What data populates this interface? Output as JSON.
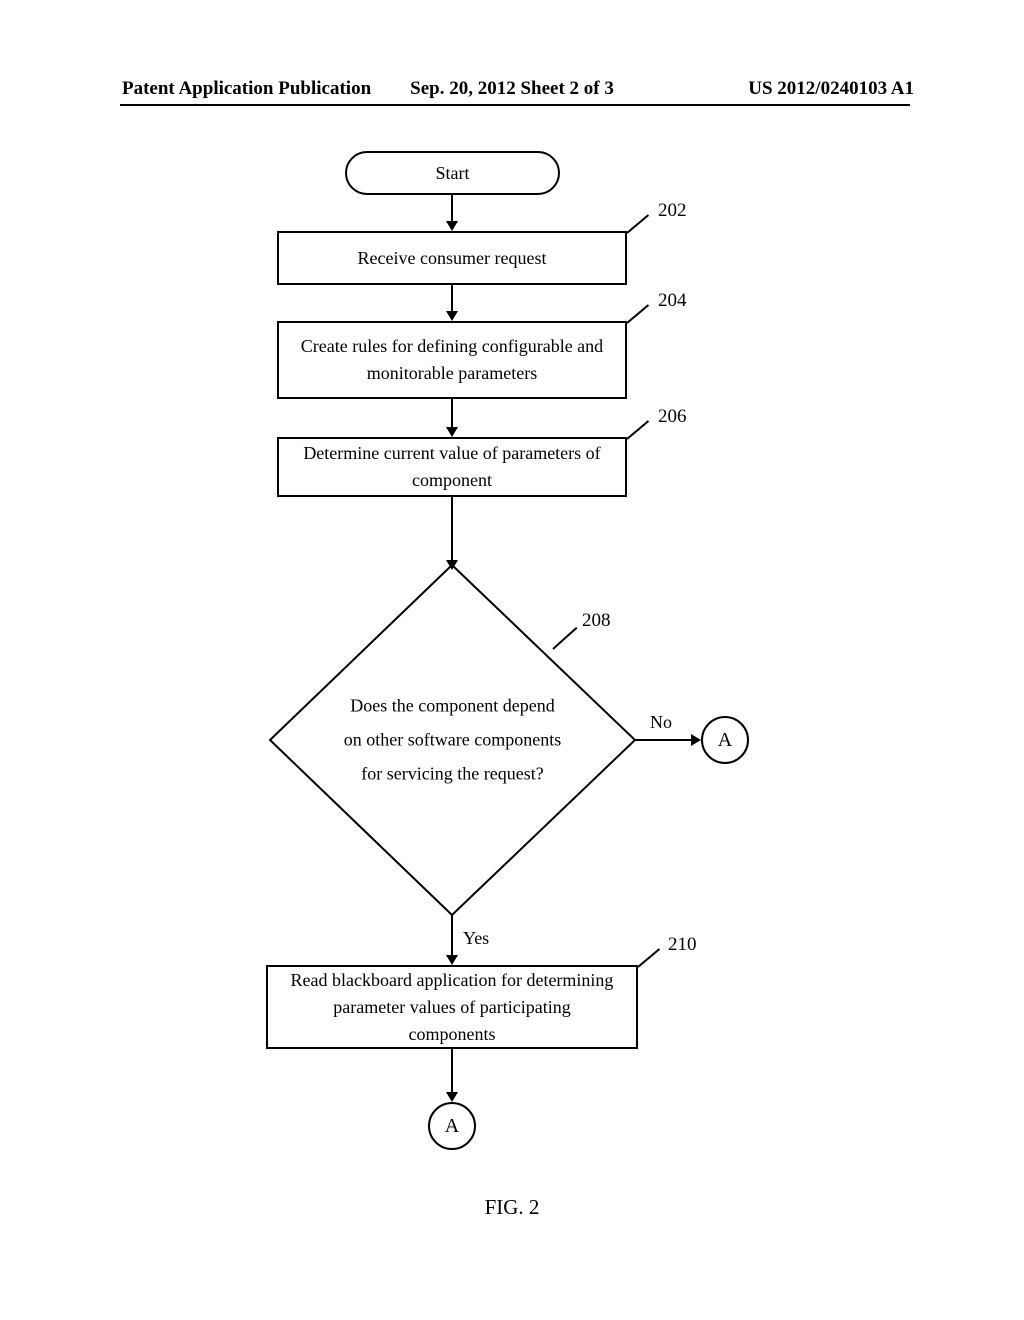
{
  "header": {
    "left": "Patent Application Publication",
    "center": "Sep. 20, 2012  Sheet 2 of 3",
    "right": "US 2012/0240103 A1"
  },
  "flow": {
    "start": "Start",
    "step202": {
      "ref": "202",
      "text": "Receive consumer request"
    },
    "step204": {
      "ref": "204",
      "text_l1": "Create rules for defining configurable and",
      "text_l2": "monitorable parameters"
    },
    "step206": {
      "ref": "206",
      "text_l1": "Determine current value of parameters of",
      "text_l2": "component"
    },
    "decision208": {
      "ref": "208",
      "line1": "Does the component depend",
      "line2": "on other software components",
      "line3": "for servicing the request?",
      "yes": "Yes",
      "no": "No"
    },
    "step210": {
      "ref": "210",
      "text_l1": "Read blackboard application for determining",
      "text_l2": "parameter values of participating",
      "text_l3": "components"
    },
    "connectorA": "A"
  },
  "caption": "FIG. 2"
}
